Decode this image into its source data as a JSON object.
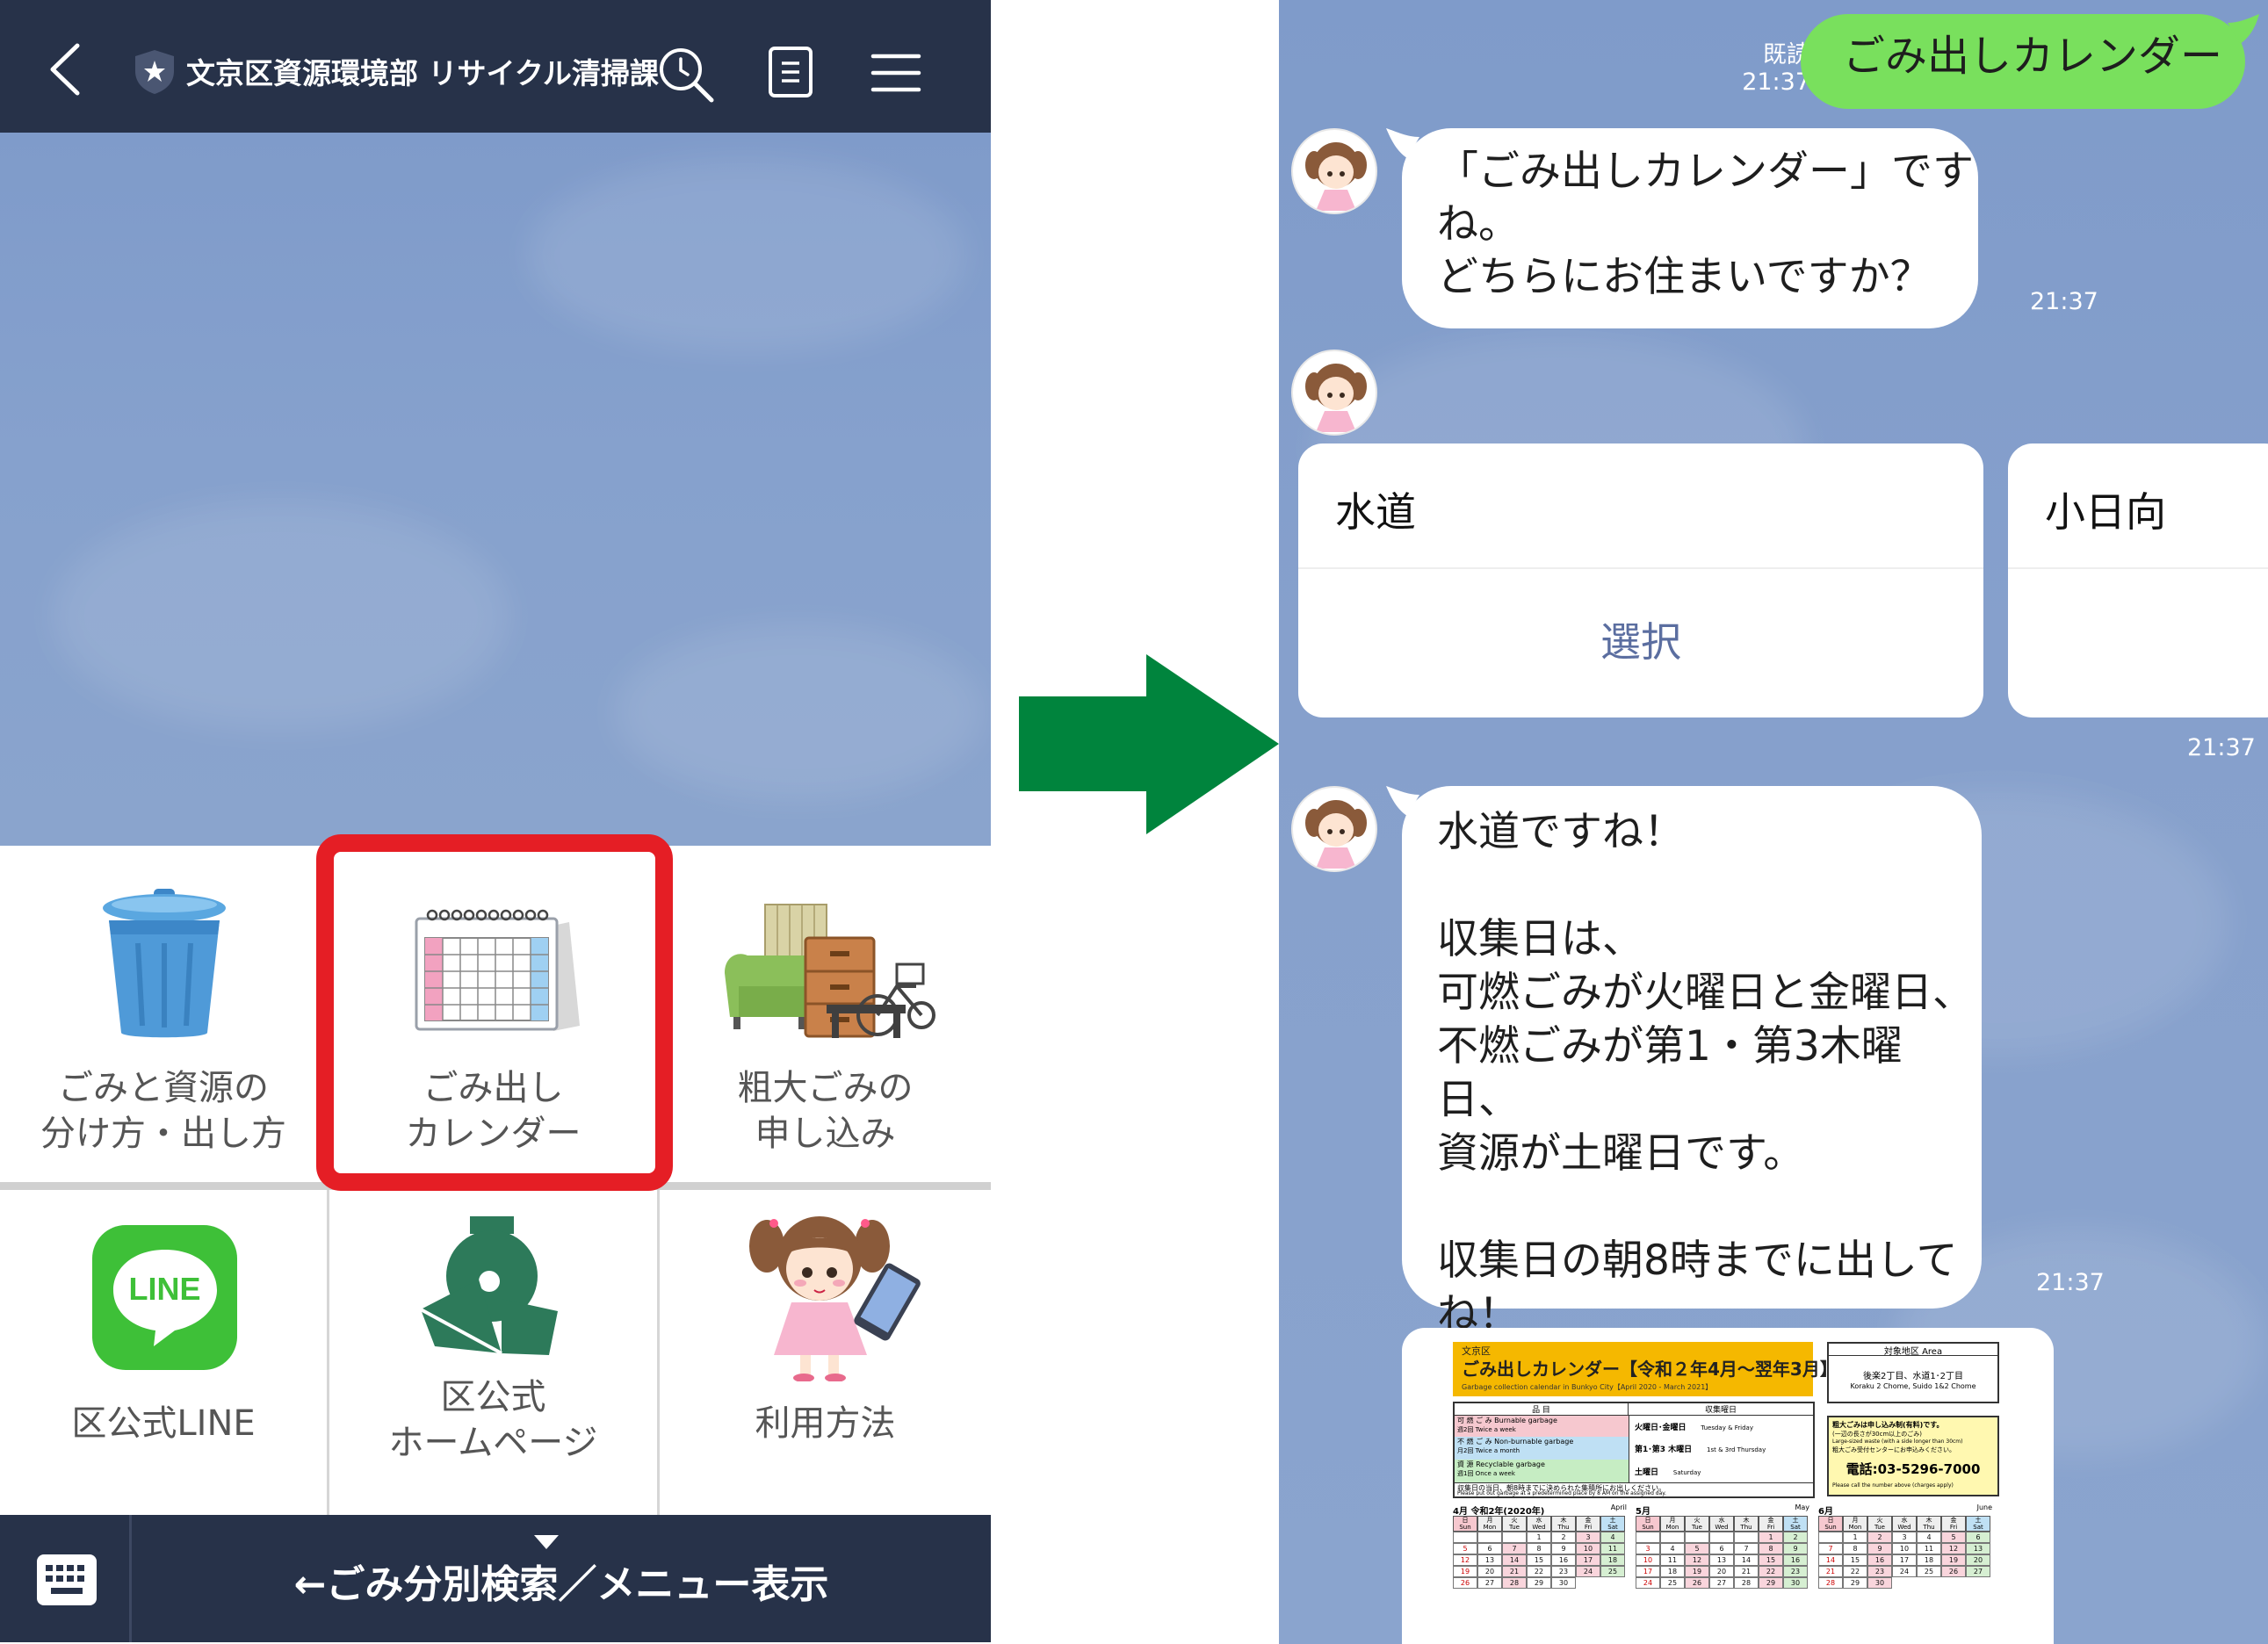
{
  "left": {
    "header": {
      "title": "文京区資源環境部 リサイクル清掃課",
      "back_icon": "chevron-left-icon",
      "verified_icon": "shield-star-icon",
      "search_icon": "search-icon",
      "notes_icon": "notes-icon",
      "menu_icon": "hamburger-menu-icon",
      "bg_color": "#273249"
    },
    "menu": {
      "items": [
        {
          "line1": "ごみと資源の",
          "line2": "分け方・出し方",
          "icon": "trash-can-icon"
        },
        {
          "line1": "ごみ出し",
          "line2": "カレンダー",
          "icon": "calendar-icon",
          "highlighted": true
        },
        {
          "line1": "粗大ごみの",
          "line2": "申し込み",
          "icon": "bulky-furniture-icon"
        },
        {
          "line1": "区公式LINE",
          "line2": "",
          "icon": "line-logo-icon"
        },
        {
          "line1": "区公式",
          "line2": "ホームページ",
          "icon": "bunkyo-emblem-icon"
        },
        {
          "line1": "利用方法",
          "line2": "",
          "icon": "mascot-girl-icon"
        }
      ],
      "highlight_color": "#e51e25"
    },
    "line_logo_text": "LINE",
    "bottom_bar": {
      "label": "←ごみ分別検索／メニュー表示",
      "keyboard_icon": "keyboard-icon"
    }
  },
  "arrow": {
    "icon": "right-arrow-icon",
    "color": "#00843d"
  },
  "right": {
    "messages": [
      {
        "from": "user",
        "read_label": "既読",
        "time": "21:37",
        "text": "ごみ出しカレンダー",
        "bubble_color": "#79e05d"
      },
      {
        "from": "bot",
        "lines": [
          "「ごみ出しカレンダー」です",
          "ね。",
          "どちらにお住まいですか？"
        ],
        "time": "21:37"
      },
      {
        "from": "bot",
        "type": "carousel",
        "cards": [
          {
            "title": "水道",
            "button": "選択"
          },
          {
            "title": "小日向",
            "button": ""
          }
        ],
        "time": "21:37"
      },
      {
        "from": "bot",
        "lines": [
          "水道ですね！",
          "",
          "収集日は、",
          "可燃ごみが火曜日と金曜日、",
          "不燃ごみが第1・第3木曜日、",
          "資源が土曜日です。",
          "",
          "収集日の朝8時までに出して",
          "ね！"
        ],
        "time": "21:37"
      },
      {
        "from": "bot",
        "type": "image",
        "image": {
          "ward": "文京区",
          "title": "ごみ出しカレンダー【令和２年4月〜翌年3月】",
          "subtitle": "Garbage collection calendar in Bunkyo City【April 2020 - March 2021】",
          "area_label": "対象地区 Area",
          "area_jp": "後楽2丁目、水道1･2丁目",
          "area_en": "Koraku 2 Chome, Suido 1&2 Chome",
          "table_header": [
            "品 目",
            "収集曜日"
          ],
          "rows": [
            {
              "item": "可 燃 ご み Burnable garbage",
              "freq": "週2回 Twice a week",
              "day": "火曜日･金曜日",
              "day_en": "Tuesday & Friday"
            },
            {
              "item": "不 燃 ご み Non-burnable garbage",
              "freq": "月2回 Twice a month",
              "day": "第1･第3 木曜日",
              "day_en": "1st & 3rd Thursday"
            },
            {
              "item": "資 源 Recyclable garbage",
              "freq": "週1回 Once a week",
              "day": "土曜日",
              "day_en": "Saturday"
            }
          ],
          "note_jp": "収集日の当日、朝8時までに決められた集積所にお出しください。",
          "note_en": "Please put out garbage at a predetermined place by 8 AM on the assigned day.",
          "bulky_title": "粗大ごみは申し込み制(有料)です。",
          "bulky_sub": "(一辺の長さが30cm以上のごみ)",
          "bulky_en": "Large-sized waste (with a side longer than 30cm)",
          "bulky_center": "粗大ごみ受付センターにお申込みください。",
          "phone": "電話:03-5296-7000",
          "phone_en": "Please call the number above (charges apply)",
          "months": [
            {
              "jp": "4月 令和2年(2020年)",
              "en": "April"
            },
            {
              "jp": "5月",
              "en": "May"
            },
            {
              "jp": "6月",
              "en": "June"
            }
          ],
          "weekdays": [
            "日",
            "月",
            "火",
            "水",
            "木",
            "金",
            "土"
          ],
          "weekdays_en": [
            "Sun",
            "Mon",
            "Tue",
            "Wed",
            "Thu",
            "Fri",
            "Sat"
          ],
          "april": [
            "",
            "",
            "",
            "1",
            "2",
            "3",
            "4",
            "5",
            "6",
            "7",
            "8",
            "9",
            "10",
            "11",
            "12",
            "13",
            "14",
            "15",
            "16",
            "17",
            "18",
            "19",
            "20",
            "21",
            "22",
            "23",
            "24",
            "25",
            "26",
            "27",
            "28",
            "29",
            "30"
          ],
          "may": [
            "",
            "",
            "",
            "",
            "",
            "1",
            "2",
            "3",
            "4",
            "5",
            "6",
            "7",
            "8",
            "9",
            "10",
            "11",
            "12",
            "13",
            "14",
            "15",
            "16",
            "17",
            "18",
            "19",
            "20",
            "21",
            "22",
            "23",
            "24",
            "25",
            "26",
            "27",
            "28",
            "29",
            "30"
          ],
          "june": [
            "",
            "1",
            "2",
            "3",
            "4",
            "5",
            "6",
            "7",
            "8",
            "9",
            "10",
            "11",
            "12",
            "13",
            "14",
            "15",
            "16",
            "17",
            "18",
            "19",
            "20",
            "21",
            "22",
            "23",
            "24",
            "25",
            "26",
            "27",
            "28",
            "29",
            "30"
          ]
        }
      }
    ],
    "avatar_icon": "mascot-avatar-icon"
  }
}
